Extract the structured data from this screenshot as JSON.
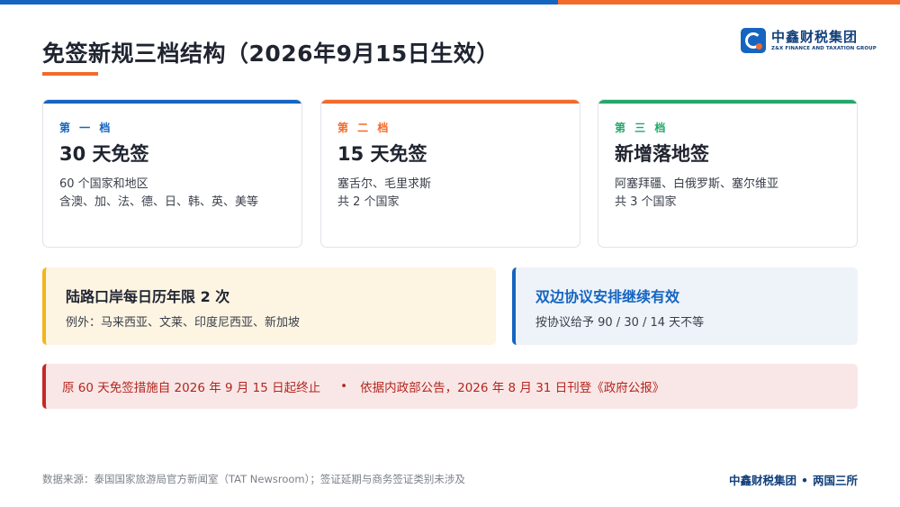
{
  "header": {
    "title": "免签新规三档结构（2026年9月15日生效）",
    "logo_cn": "中鑫财税集团",
    "logo_en": "Z&X FINANCE AND TAXATION GROUP"
  },
  "tiers": [
    {
      "tier": "第 一 档",
      "heading": "30 天免签",
      "line1": "60 个国家和地区",
      "line2": "含澳、加、法、德、日、韩、英、美等"
    },
    {
      "tier": "第 二 档",
      "heading": "15 天免签",
      "line1": "塞舌尔、毛里求斯",
      "line2": "共 2 个国家"
    },
    {
      "tier": "第 三 档",
      "heading": "新增落地签",
      "line1": "阿塞拜疆、白俄罗斯、塞尔维亚",
      "line2": "共 3 个国家"
    }
  ],
  "panels": {
    "land": {
      "title": "陆路口岸每日历年限 2 次",
      "text": "例外：马来西亚、文莱、印度尼西亚、新加坡"
    },
    "bilateral": {
      "title": "双边协议安排继续有效",
      "text": "按协议给予 90 / 30 / 14 天不等"
    }
  },
  "notice": {
    "part1": "原 60 天免签措施自 2026 年 9 月 15 日起终止",
    "separator": "•",
    "part2": "依据内政部公告，2026 年 8 月 31 日刊登《政府公报》"
  },
  "footer": {
    "source": "数据来源：泰国国家旅游局官方新闻室（TAT Newsroom）；签证延期与商务签证类别未涉及",
    "brand_left": "中鑫财税集团",
    "brand_sep": "•",
    "brand_right": "两国三所"
  },
  "colors": {
    "primary_blue": "#1565c0",
    "accent_orange": "#f26b2a",
    "tier_green": "#22a86b",
    "warning_yellow": "#f2b51f",
    "alert_red": "#c62828"
  }
}
